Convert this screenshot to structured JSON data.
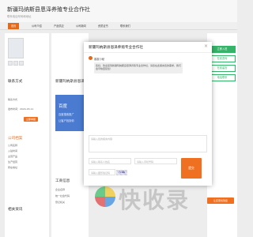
{
  "header": {
    "title": "新疆玛纳斯县恩泽养殖专业合作社",
    "subtitle": "联系电话号码和地址"
  },
  "nav": {
    "items": [
      "首页",
      "公司介绍",
      "产品供应",
      "公司新闻",
      "资质证书",
      "联系我们"
    ]
  },
  "left": {
    "contact_title": "联系方式",
    "phone_label": "联系方式",
    "updated": "发布时间：2024-03-11",
    "report_button": "立即举报",
    "company_section": "公司档案",
    "company_lines": [
      "公司名称",
      "入驻时间",
      "主营产品",
      "生产经营",
      "所在地址"
    ],
    "news_section": "相关资讯"
  },
  "middle": {
    "intro_title": "新疆玛纳斯县恩泽",
    "ad_title": "百度",
    "ad_line1": "百度搜索推广",
    "ad_line2": "让客户找到你",
    "biz_title": "工商信息",
    "biz_lines": [
      "企业名称",
      "统一社会代码",
      "登记机关"
    ]
  },
  "right": {
    "promo_text": "让买家找到您",
    "buttons": [
      "立即入驻",
      "在线咨询",
      "在线留言",
      "电话联系"
    ]
  },
  "modal": {
    "title": "新疆玛纳斯县恩泽养殖专业合作社",
    "close_glyph": "×",
    "agent_name": "客服小秘",
    "message": "您好，欢迎来到新疆玛纳斯县恩泽养殖专业合作社，请您在此留言您的需求，我们会尽快回复您！",
    "message_placeholder": "请输入您的留言内容",
    "name_placeholder": "请输入联系人姓名",
    "phone_placeholder": "请输入手机号码",
    "captcha_placeholder": "请输入图形验证码",
    "captcha_text": "7c4k",
    "submit_label": "提交"
  },
  "watermark": {
    "text": "快收录"
  },
  "colors": {
    "accent": "#f07021",
    "green": "#35b368",
    "ad_blue": "#4a7bd1"
  }
}
